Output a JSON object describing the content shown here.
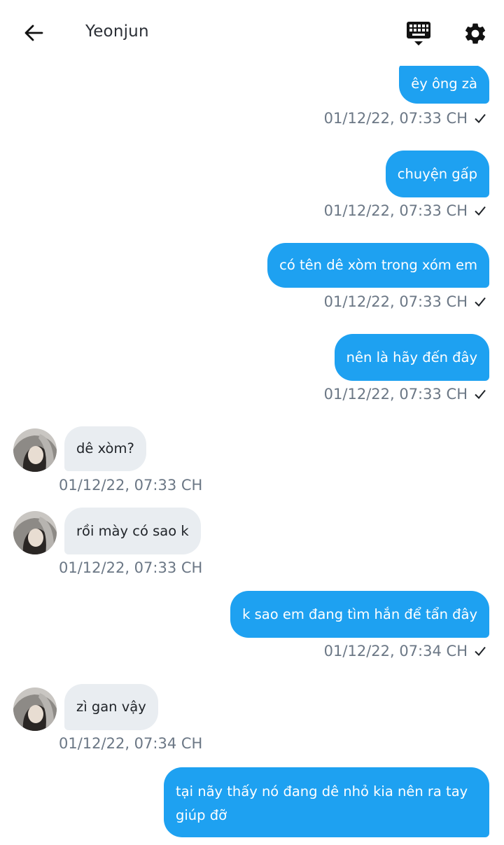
{
  "header": {
    "title": "Yeonjun",
    "back_icon": "arrow-left-icon",
    "keyboard_icon": "keyboard-icon",
    "settings_icon": "gear-icon"
  },
  "colors": {
    "outgoing_bubble": "#1ea1f1",
    "incoming_bubble": "#e9edf1",
    "timestamp": "#6b7785"
  },
  "messages": [
    {
      "side": "out",
      "text": "êy ông zà",
      "time": "01/12/22,  07:33 CH",
      "read": true
    },
    {
      "side": "out",
      "text": "chuyện gấp",
      "time": "01/12/22,  07:33 CH",
      "read": true
    },
    {
      "side": "out",
      "text": "có tên dê xòm trong xóm em",
      "time": "01/12/22,  07:33 CH",
      "read": true
    },
    {
      "side": "out",
      "text": "nên là hãy đến đây",
      "time": "01/12/22,  07:33 CH",
      "read": true
    },
    {
      "side": "in",
      "text": "dê xòm?",
      "time": "01/12/22,  07:33 CH"
    },
    {
      "side": "in",
      "text": "rồi mày có sao k",
      "time": "01/12/22,  07:33 CH"
    },
    {
      "side": "out",
      "text": "k sao em đang tìm hắn để tẩn đây",
      "time": "01/12/22,  07:34 CH",
      "read": true
    },
    {
      "side": "in",
      "text": "zì gan vậy",
      "time": "01/12/22,  07:34 CH"
    },
    {
      "side": "out",
      "text": "tại nãy thấy nó đang dê nhỏ kia nên ra tay giúp đỡ",
      "time": "",
      "read": false
    }
  ]
}
